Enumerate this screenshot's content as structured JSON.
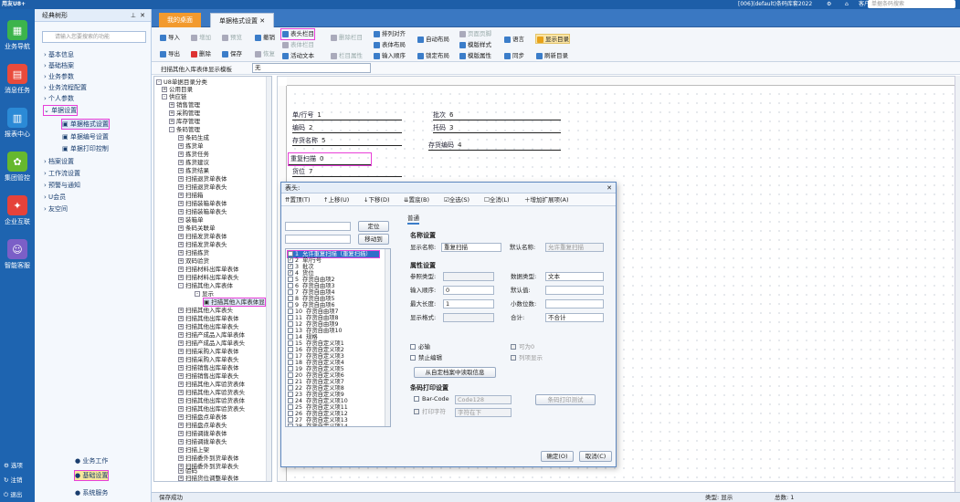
{
  "titlebar": {
    "app": "用友U8+",
    "right_info": "[006](default)条码库套2022",
    "dropdown": "客户服务",
    "search_placeholder": "单据条码搜索"
  },
  "leftnav": {
    "items": [
      {
        "label": "业务导航"
      },
      {
        "label": "消息任务"
      },
      {
        "label": "报表中心"
      },
      {
        "label": "集团管控"
      },
      {
        "label": "企业互联"
      },
      {
        "label": "智能客服"
      }
    ],
    "bottom": [
      {
        "label": "选项"
      },
      {
        "label": "注销"
      },
      {
        "label": "退出"
      }
    ]
  },
  "menu": {
    "title": "经典树形",
    "search_placeholder": "请输入您要搜索的功能",
    "items": [
      {
        "label": "基本信息"
      },
      {
        "label": "基础档案"
      },
      {
        "label": "业务参数"
      },
      {
        "label": "业务流程配置"
      },
      {
        "label": "个人参数"
      },
      {
        "label": "单据设置"
      },
      {
        "label": "单据格式设置"
      },
      {
        "label": "单据编号设置"
      },
      {
        "label": "单据打印控制"
      },
      {
        "label": "档案设置"
      },
      {
        "label": "工作流设置"
      },
      {
        "label": "预警与通知"
      },
      {
        "label": "U会员"
      },
      {
        "label": "友空间"
      }
    ],
    "bottom": [
      {
        "label": "业务工作"
      },
      {
        "label": "基础设置"
      },
      {
        "label": "系统服务"
      }
    ]
  },
  "tabs": [
    {
      "label": "我的桌面"
    },
    {
      "label": "单据格式设置"
    }
  ],
  "toolbar": {
    "items": [
      {
        "label": "导入"
      },
      {
        "label": "增加"
      },
      {
        "label": "预览"
      },
      {
        "label": "撤销"
      },
      {
        "label": "导出"
      },
      {
        "label": "删除"
      },
      {
        "label": "保存"
      },
      {
        "label": "恢复"
      },
      {
        "label": "表头栏目"
      },
      {
        "label": "表体栏目"
      },
      {
        "label": "删除栏目"
      },
      {
        "label": "活动文本"
      },
      {
        "label": "栏目属性"
      },
      {
        "label": "排列对齐"
      },
      {
        "label": "表体布局"
      },
      {
        "label": "输入顺序"
      },
      {
        "label": "自动布局"
      },
      {
        "label": "锁定布局"
      },
      {
        "label": "页面页脚"
      },
      {
        "label": "模版样式"
      },
      {
        "label": "模版属性"
      },
      {
        "label": "语言"
      },
      {
        "label": "同步"
      },
      {
        "label": "显示目录"
      },
      {
        "label": "刷新目录"
      }
    ]
  },
  "combostrip": {
    "template": "扫描其他入库表体显示模板",
    "value": "无"
  },
  "tree": {
    "root": "U8单据目录分类",
    "nodes": [
      {
        "label": "公用目录"
      },
      {
        "label": "供应链"
      },
      {
        "label": "销售管理"
      },
      {
        "label": "采购管理"
      },
      {
        "label": "库存管理"
      },
      {
        "label": "条码管理"
      },
      {
        "label": "条码生成"
      },
      {
        "label": "拣货单"
      },
      {
        "label": "拣货任务"
      },
      {
        "label": "拣货建议"
      },
      {
        "label": "拣货结果"
      },
      {
        "label": "扫描退货单表体"
      },
      {
        "label": "扫描退货单表头"
      },
      {
        "label": "扫描箱"
      },
      {
        "label": "扫描装箱单表体"
      },
      {
        "label": "扫描装箱单表头"
      },
      {
        "label": "装箱单"
      },
      {
        "label": "条码关联单"
      },
      {
        "label": "扫描发货单表体"
      },
      {
        "label": "扫描发货单表头"
      },
      {
        "label": "扫描拣货"
      },
      {
        "label": "双码验货"
      },
      {
        "label": "扫描材料出库单表体"
      },
      {
        "label": "扫描材料出库单表头"
      },
      {
        "label": "扫描其他入库表体"
      },
      {
        "label": "显示"
      },
      {
        "label": "扫描其他入库表体显"
      },
      {
        "label": "扫描其他入库表头"
      },
      {
        "label": "扫描其他出库单表体"
      },
      {
        "label": "扫描其他出库单表头"
      },
      {
        "label": "扫描产成品入库单表体"
      },
      {
        "label": "扫描产成品入库单表头"
      },
      {
        "label": "扫描采购入库单表体"
      },
      {
        "label": "扫描采购入库单表头"
      },
      {
        "label": "扫描销售出库单表体"
      },
      {
        "label": "扫描销售出库单表头"
      },
      {
        "label": "扫描其他入库验货表体"
      },
      {
        "label": "扫描其他入库验货表头"
      },
      {
        "label": "扫描其他出库验货表体"
      },
      {
        "label": "扫描其他出库验货表头"
      },
      {
        "label": "扫描盘点单表体"
      },
      {
        "label": "扫描盘点单表头"
      },
      {
        "label": "扫描调拨单表体"
      },
      {
        "label": "扫描调拨单表头"
      },
      {
        "label": "扫描上架"
      },
      {
        "label": "扫描委外到货单表体"
      },
      {
        "label": "扫描委外到货单表头"
      },
      {
        "label": "验码"
      },
      {
        "label": "扫描货位调整单表体"
      }
    ]
  },
  "canvas": {
    "fields": [
      {
        "label": "单/行号",
        "num": "1"
      },
      {
        "label": "批次",
        "num": "6"
      },
      {
        "label": "编码",
        "num": "2"
      },
      {
        "label": "托码",
        "num": "3"
      },
      {
        "label": "存货名称",
        "num": "5"
      },
      {
        "label": "存货编码",
        "num": "4"
      },
      {
        "label": "重复扫描",
        "num": "0"
      },
      {
        "label": "货位",
        "num": "7"
      }
    ]
  },
  "dialog": {
    "title": "表头:",
    "tools": [
      {
        "label": "置顶(T)"
      },
      {
        "label": "上移(U)"
      },
      {
        "label": "下移(D)"
      },
      {
        "label": "置底(B)"
      },
      {
        "label": "全选(S)"
      },
      {
        "label": "全消(L)"
      },
      {
        "label": "增加扩展项(A)"
      }
    ],
    "locate_button": "定位",
    "move_button": "移动到",
    "field_list": [
      {
        "label": "允许重复扫描（重复扫描）",
        "checked": true
      },
      {
        "label": "单/行号",
        "checked": true
      },
      {
        "label": "批次",
        "checked": true
      },
      {
        "label": "货位",
        "checked": true
      },
      {
        "label": "存货自由项2",
        "checked": false
      },
      {
        "label": "存货自由项3",
        "checked": false
      },
      {
        "label": "存货自由项4",
        "checked": false
      },
      {
        "label": "存货自由项5",
        "checked": false
      },
      {
        "label": "存货自由项6",
        "checked": false
      },
      {
        "label": "存货自由项7",
        "checked": false
      },
      {
        "label": "存货自由项8",
        "checked": false
      },
      {
        "label": "存货自由项9",
        "checked": false
      },
      {
        "label": "存货自由项10",
        "checked": false
      },
      {
        "label": "规格",
        "checked": false
      },
      {
        "label": "存货自定义项1",
        "checked": false
      },
      {
        "label": "存货自定义项2",
        "checked": false
      },
      {
        "label": "存货自定义项3",
        "checked": false
      },
      {
        "label": "存货自定义项4",
        "checked": false
      },
      {
        "label": "存货自定义项5",
        "checked": false
      },
      {
        "label": "存货自定义项6",
        "checked": false
      },
      {
        "label": "存货自定义项7",
        "checked": false
      },
      {
        "label": "存货自定义项8",
        "checked": false
      },
      {
        "label": "存货自定义项9",
        "checked": false
      },
      {
        "label": "存货自定义项10",
        "checked": false
      },
      {
        "label": "存货自定义项11",
        "checked": false
      },
      {
        "label": "存货自定义项12",
        "checked": false
      },
      {
        "label": "存货自定义项13",
        "checked": false
      },
      {
        "label": "存货自定义项14",
        "checked": false
      }
    ],
    "tab": "普通",
    "name_section": "名称设置",
    "display_name_label": "显示名称:",
    "display_name_value": "重复扫描",
    "default_name_label": "默认名称:",
    "default_name_value": "允许重复扫描",
    "attr_section": "属性设置",
    "ref_type_label": "参照类型:",
    "data_type_label": "数据类型:",
    "data_type_value": "文本",
    "input_order_label": "输入顺序:",
    "input_order_value": "0",
    "default_value_label": "默认值:",
    "max_len_label": "最大长度:",
    "max_len_value": "1",
    "decimals_label": "小数位数:",
    "display_fmt_label": "显示格式:",
    "total_label": "合计:",
    "total_value": "不合计",
    "required_label": "必输",
    "no_edit_label": "禁止编辑",
    "can_zero_label": "可为0",
    "list_show_label": "列项显示",
    "read_archive_button": "从自定档案中读取信息",
    "barcode_section": "条码打印设置",
    "barcode_label": "Bar-Code",
    "barcode_value": "Code128",
    "print_text_label": "打印字符",
    "print_text_value": "字符在下",
    "barcode_test_button": "条码打印测试",
    "ok_button": "确定(O)",
    "cancel_button": "取消(C)"
  },
  "status": {
    "left": "保存成功",
    "type": "类型: 显示",
    "total": "总数: 1"
  }
}
